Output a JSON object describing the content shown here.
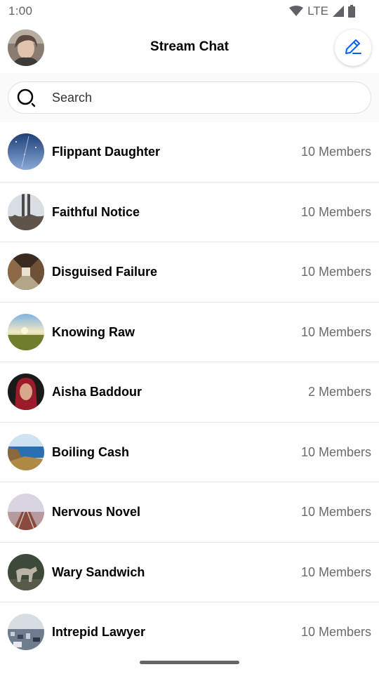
{
  "status_bar": {
    "time": "1:00",
    "network": "LTE"
  },
  "header": {
    "title": "Stream Chat",
    "avatar_icon": "user-avatar",
    "compose_icon": "pencil-icon",
    "accent_color": "#005fff"
  },
  "search": {
    "placeholder": "Search",
    "value": ""
  },
  "channels": [
    {
      "name": "Flippant Daughter",
      "members": "10 Members",
      "avatar_icon": "night-sky-photo"
    },
    {
      "name": "Faithful Notice",
      "members": "10 Members",
      "avatar_icon": "legs-on-rocks-photo"
    },
    {
      "name": "Disguised Failure",
      "members": "10 Members",
      "avatar_icon": "corridor-photo"
    },
    {
      "name": "Knowing Raw",
      "members": "10 Members",
      "avatar_icon": "sunset-field-photo"
    },
    {
      "name": "Aisha Baddour",
      "members": "2 Members",
      "avatar_icon": "woman-portrait-photo"
    },
    {
      "name": "Boiling Cash",
      "members": "10 Members",
      "avatar_icon": "coast-photo"
    },
    {
      "name": "Nervous Novel",
      "members": "10 Members",
      "avatar_icon": "railway-photo"
    },
    {
      "name": "Wary Sandwich",
      "members": "10 Members",
      "avatar_icon": "wolf-photo"
    },
    {
      "name": "Intrepid Lawyer",
      "members": "10 Members",
      "avatar_icon": "city-photo"
    }
  ]
}
